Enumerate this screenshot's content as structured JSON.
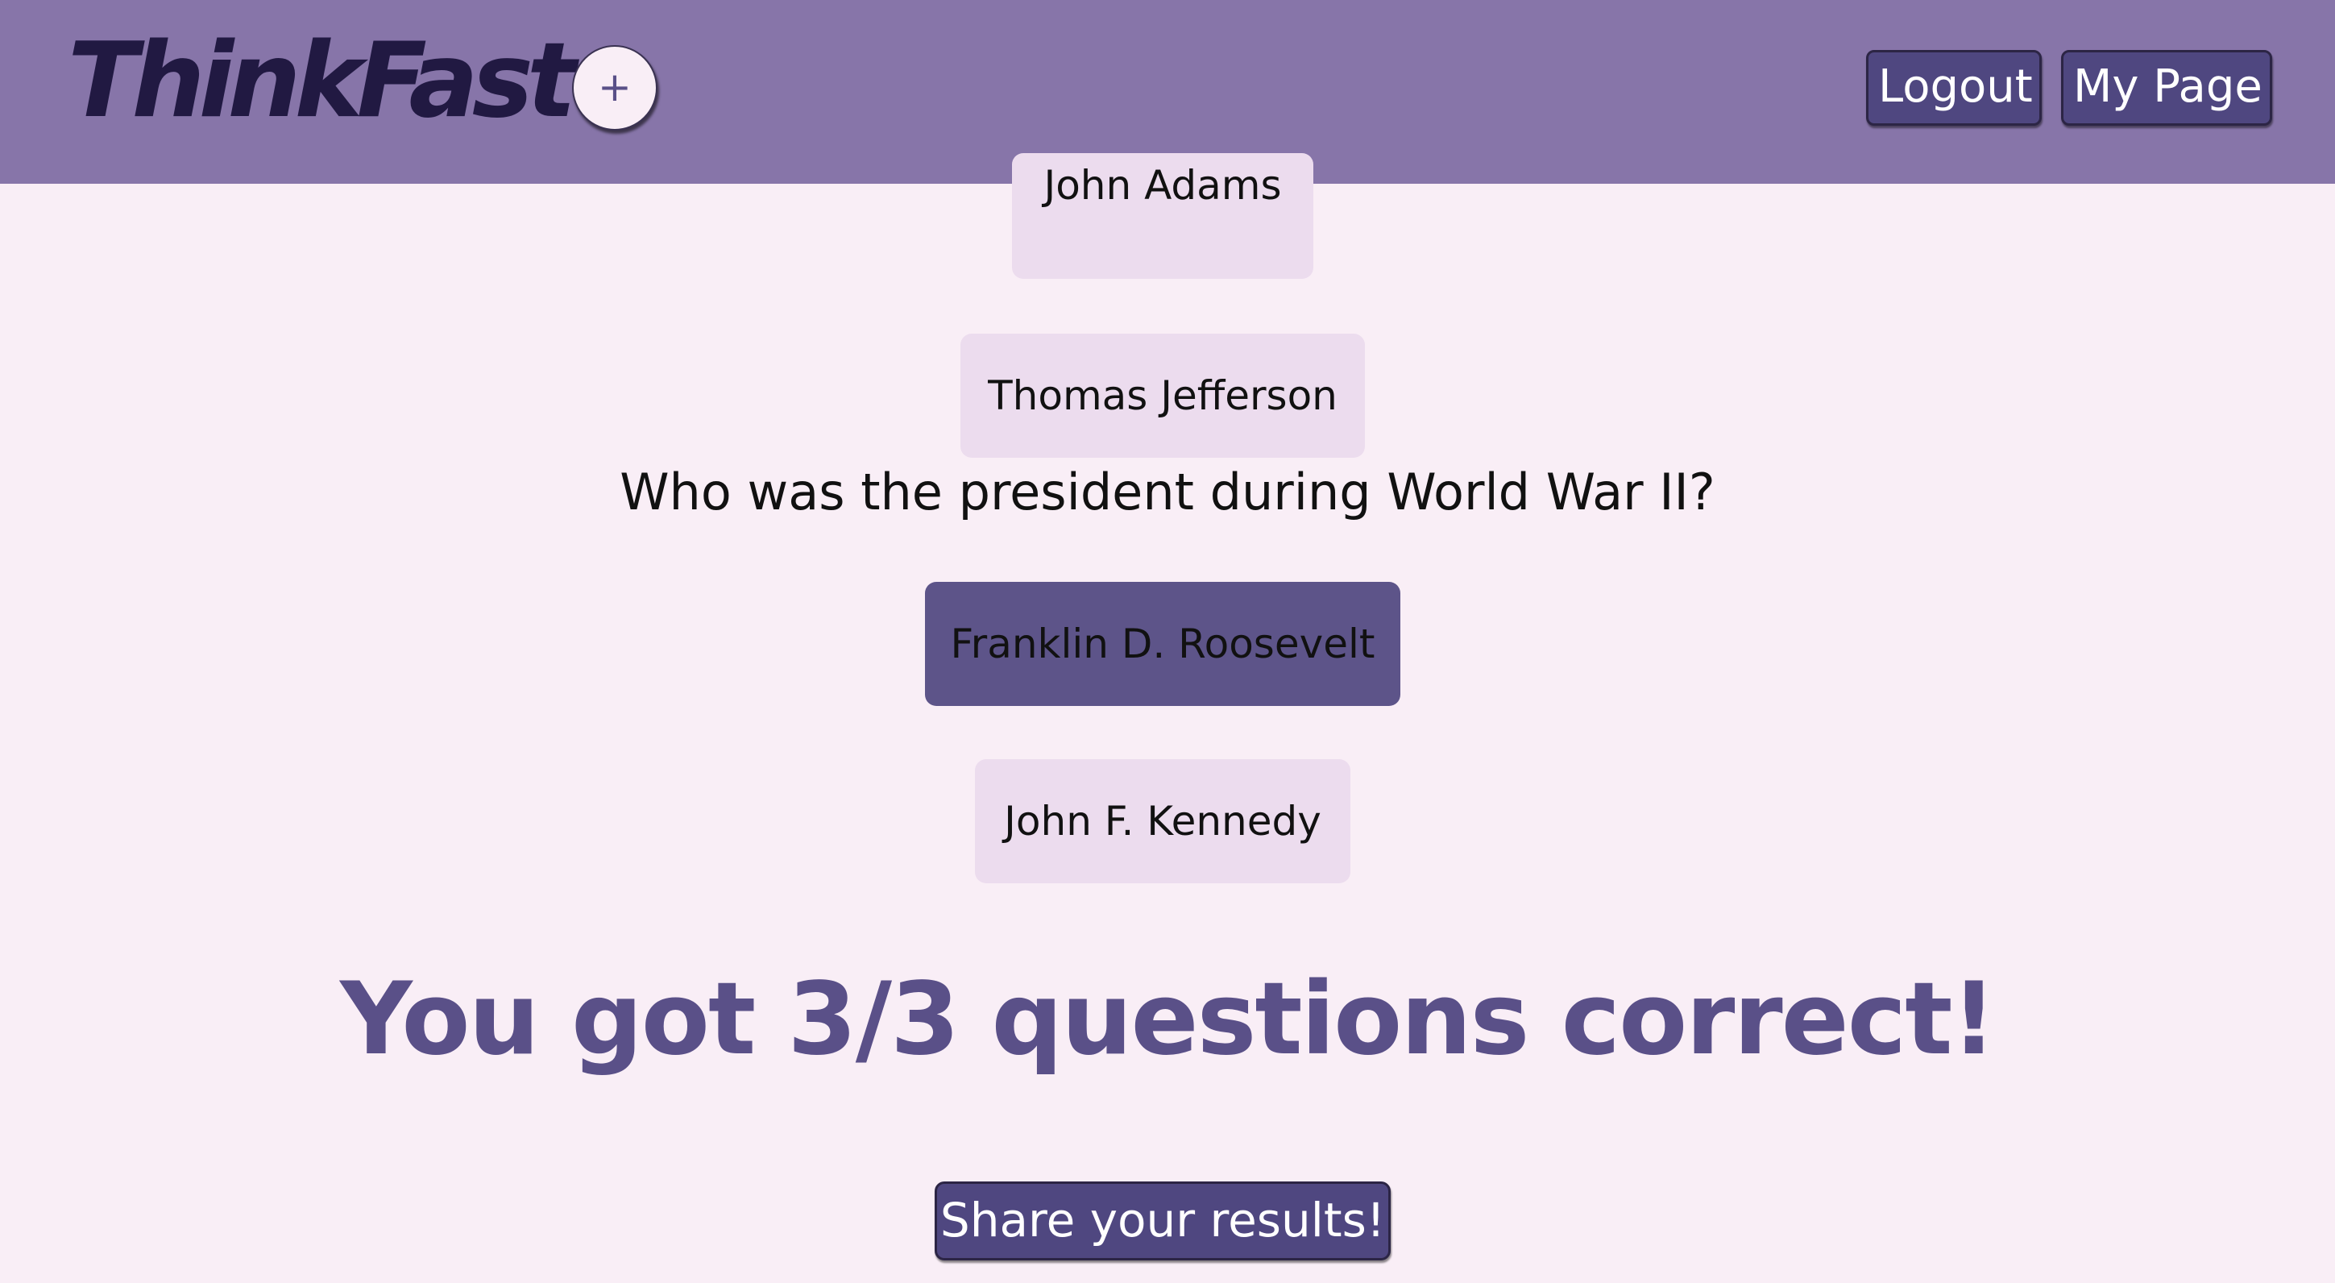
{
  "header": {
    "logo_text": "ThinkFast",
    "add_label": "+",
    "logout_label": "Logout",
    "mypage_label": "My Page"
  },
  "quiz": {
    "prev_options": [
      "John Adams",
      "Thomas Jefferson"
    ],
    "question": "Who was the president during World War II?",
    "options": [
      "Franklin D. Roosevelt",
      "John F. Kennedy"
    ],
    "selected_option": "Franklin D. Roosevelt"
  },
  "result": {
    "message": "You got 3/3 questions correct!",
    "share_label": "Share your results!"
  },
  "colors": {
    "header_bg": "#8775a9",
    "page_bg": "#f9eef6",
    "accent": "#5a5088",
    "option_bg": "#ecdcee",
    "option_selected_bg": "#5d5489"
  }
}
